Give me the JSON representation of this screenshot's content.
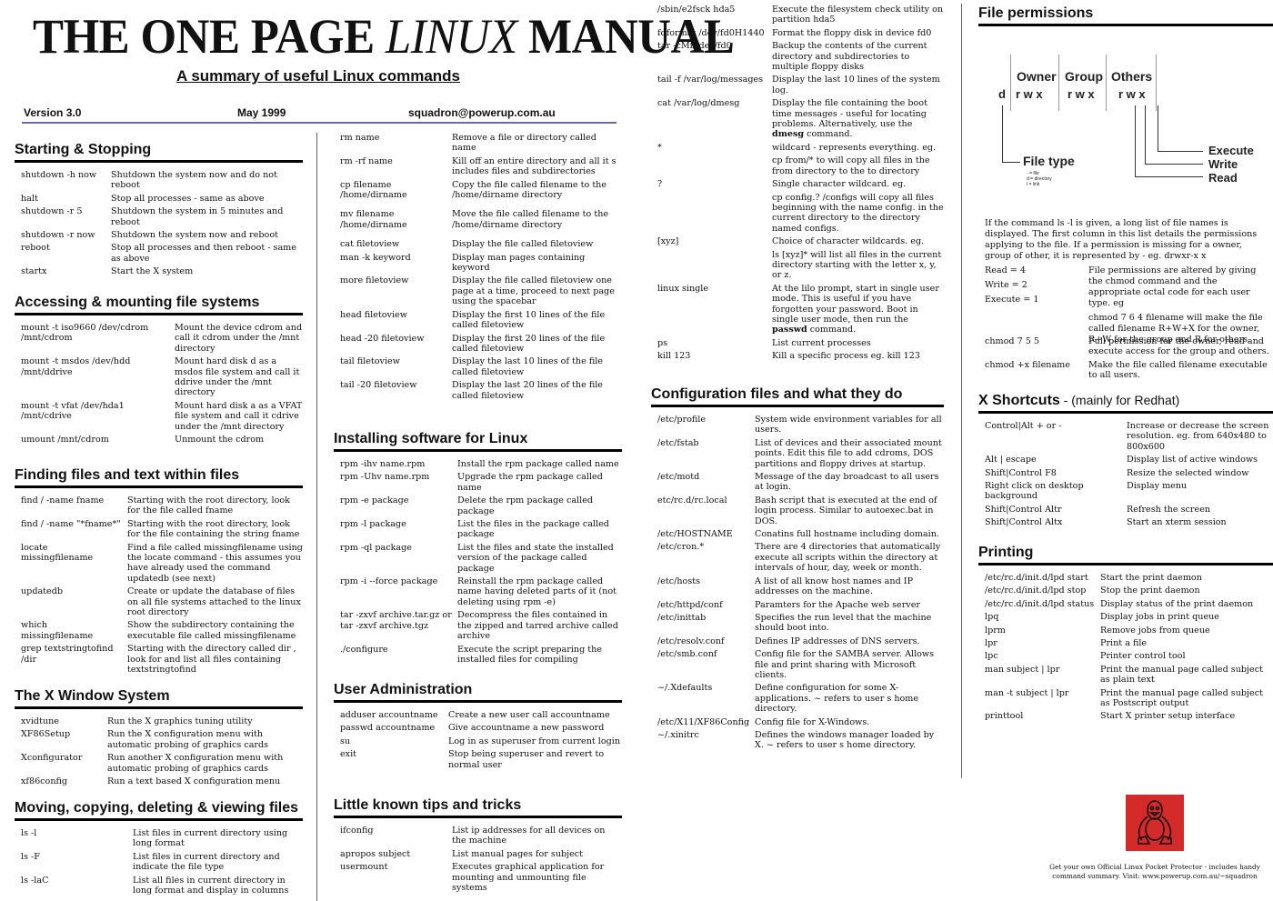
{
  "header": {
    "title_part1": "THE ONE PAGE ",
    "title_italic": "LINUX",
    "title_part2": " MANUAL",
    "subtitle": "A summary of useful Linux commands",
    "version": "Version 3.0",
    "date": "May 1999",
    "email": "squadron@powerup.com.au"
  },
  "sections": {
    "starting": {
      "title": "Starting & Stopping",
      "rows": [
        {
          "cmd": "shutdown -h now",
          "desc": "Shutdown the system now and do not reboot"
        },
        {
          "cmd": "halt",
          "desc": "Stop all processes - same as above"
        },
        {
          "cmd": "shutdown -r 5",
          "desc": "Shutdown the system in 5 minutes and reboot"
        },
        {
          "cmd": "shutdown -r now",
          "desc": "Shutdown the system now and reboot"
        },
        {
          "cmd": "reboot",
          "desc": "Stop all processes and then reboot - same as above"
        },
        {
          "cmd": "startx",
          "desc": "Start the X system"
        }
      ]
    },
    "mounting": {
      "title": "Accessing & mounting file systems",
      "rows": [
        {
          "cmd": "mount -t iso9660 /dev/cdrom /mnt/cdrom",
          "desc": "Mount the device cdrom and call it cdrom under the /mnt directory"
        },
        {
          "cmd": "mount -t msdos /dev/hdd /mnt/ddrive",
          "desc": "Mount hard disk  d  as a msdos file system and call it ddrive under the /mnt directory"
        },
        {
          "cmd": "mount -t vfat /dev/hda1 /mnt/cdrive",
          "desc": "Mount hard disk  a  as a VFAT file system and call it cdrive under the /mnt directory"
        },
        {
          "cmd": "umount /mnt/cdrom",
          "desc": "Unmount the cdrom"
        }
      ]
    },
    "finding": {
      "title": "Finding files and text within files",
      "rows": [
        {
          "cmd": "find / -name  fname",
          "desc": "Starting with the root directory, look for the file called fname"
        },
        {
          "cmd": "find / -name \"*fname*\"",
          "desc": "Starting with the root directory, look for the file containing the string fname"
        },
        {
          "cmd": "locate missingfilename",
          "desc": "Find a file called missingfilename using the locate command - this assumes you have already used the command updatedb (see next)"
        },
        {
          "cmd": "updatedb",
          "desc": "Create or update the database of files on all file systems attached to the linux root directory"
        },
        {
          "cmd": "which missingfilename",
          "desc": "Show the subdirectory containing the executable file  called missingfilename"
        },
        {
          "cmd": "grep textstringtofind /dir",
          "desc": "Starting with the directory called dir , look for and list all files containing textstringtofind"
        }
      ]
    },
    "xwindow": {
      "title": "The X Window System",
      "rows": [
        {
          "cmd": "xvidtune",
          "desc": "Run the X graphics tuning utility"
        },
        {
          "cmd": "XF86Setup",
          "desc": "Run the X configuration menu with automatic probing of graphics cards"
        },
        {
          "cmd": "Xconfigurator",
          "desc": "Run another X configuration menu with automatic probing of graphics cards"
        },
        {
          "cmd": "xf86config",
          "desc": "Run a text based X configuration menu"
        }
      ]
    },
    "moving": {
      "title": "Moving, copying, deleting & viewing files",
      "rows": [
        {
          "cmd": "ls -l",
          "desc": "List files in current directory using long format"
        },
        {
          "cmd": "ls -F",
          "desc": "List files in current directory and indicate the file type"
        },
        {
          "cmd": "ls -laC",
          "desc": "List all files in current directory in long format and display in columns"
        }
      ]
    },
    "moving_cont": {
      "rows": [
        {
          "cmd": "rm name",
          "desc": "Remove a file or directory called name"
        },
        {
          "cmd": "rm -rf name",
          "desc": "Kill off an entire directory and all it s includes files and subdirectories"
        },
        {
          "cmd": "cp filename /home/dirname",
          "desc": "Copy the file called filename to the /home/dirname directory"
        },
        {
          "cmd": "mv filename /home/dirname",
          "desc": "Move the file called filename to the /home/dirname directory"
        },
        {
          "cmd": "cat filetoview",
          "desc": "Display the file called filetoview"
        },
        {
          "cmd": "man -k keyword",
          "desc": "Display man pages containing keyword"
        },
        {
          "cmd": "more filetoview",
          "desc": "Display the file called filetoview one page at a time, proceed to next page using the spacebar"
        },
        {
          "cmd": "head filetoview",
          "desc": "Display the first 10 lines of the file called filetoview"
        },
        {
          "cmd": "head -20 filetoview",
          "desc": "Display the first 20 lines of the file called filetoview"
        },
        {
          "cmd": "tail filetoview",
          "desc": "Display the last 10 lines of the file called filetoview"
        },
        {
          "cmd": "tail -20 filetoview",
          "desc": "Display the last 20 lines of the file called filetoview"
        }
      ]
    },
    "installing": {
      "title": "Installing software for Linux",
      "rows": [
        {
          "cmd": "rpm -ihv name.rpm",
          "desc": "Install the rpm package called name"
        },
        {
          "cmd": "rpm -Uhv name.rpm",
          "desc": "Upgrade the rpm package called name"
        },
        {
          "cmd": "rpm -e package",
          "desc": "Delete the rpm package called package"
        },
        {
          "cmd": "rpm -l package",
          "desc": "List the files in the package called package"
        },
        {
          "cmd": "rpm -ql package",
          "desc": "List the files and state the installed version of the package called package"
        },
        {
          "cmd": "rpm -i --force package",
          "desc": "Reinstall the rpm package called name having deleted parts of it (not deleting using rpm -e)"
        },
        {
          "cmd": "tar -zxvf archive.tar.gz or tar -zxvf archive.tgz",
          "desc": "Decompress the files contained in the zipped and tarred archive called archive"
        },
        {
          "cmd": "./configure",
          "desc": "Execute the script preparing the installed files for compiling"
        }
      ]
    },
    "useradmin": {
      "title": "User Administration",
      "rows": [
        {
          "cmd": "adduser accountname",
          "desc": "Create a new user call accountname"
        },
        {
          "cmd": "passwd accountname",
          "desc": "Give accountname a new password"
        },
        {
          "cmd": "su",
          "desc": "Log in as superuser from current login"
        },
        {
          "cmd": "exit",
          "desc": "Stop being superuser and revert to normal user"
        }
      ]
    },
    "tips": {
      "title": "Little known tips and tricks",
      "rows": [
        {
          "cmd": "ifconfig",
          "desc": "List ip addresses for all devices on the machine"
        },
        {
          "cmd": "apropos subject",
          "desc": "List manual pages for subject"
        },
        {
          "cmd": "usermount",
          "desc": "Executes graphical application for mounting and unmounting file systems"
        }
      ]
    },
    "tips_cont": {
      "rows": [
        {
          "cmd": "/sbin/e2fsck hda5",
          "desc": "Execute the filesystem check utility on partition hda5"
        },
        {
          "cmd": "fdformat /dev/fd0H1440",
          "desc": "Format the floppy disk in device fd0"
        },
        {
          "cmd": "tar -cMf /dev/fd0",
          "desc": "Backup the contents of the current directory and subdirectories to multiple floppy disks"
        },
        {
          "cmd": "tail -f /var/log/messages",
          "desc": "Display the last 10 lines of the system log."
        },
        {
          "cmd": "cat /var/log/dmesg",
          "desc": "Display the file containing the boot time messages - useful for locating problems. Alternatively, use the",
          "desc_bold": "dmesg",
          "desc_tail": " command."
        },
        {
          "cmd": "*",
          "desc": "wildcard - represents everything. eg."
        },
        {
          "cmd": "",
          "desc": "cp from/* to  will copy all files in the from directory to the to directory"
        },
        {
          "cmd": "?",
          "desc": "Single character wildcard. eg."
        },
        {
          "cmd": "",
          "desc": "cp config.? /configs will copy all files beginning with the name config. in the current directory to the directory named configs."
        },
        {
          "cmd": "[xyz]",
          "desc": "Choice of character wildcards. eg."
        },
        {
          "cmd": "",
          "desc": "ls [xyz]* will list all files in the current directory starting with the letter x, y, or z."
        },
        {
          "cmd": "linux single",
          "desc": "At the lilo prompt, start in single user mode. This is useful if you have forgotten your password. Boot in single user mode, then run the",
          "desc_bold": "passwd",
          "desc_tail": " command."
        },
        {
          "cmd": "ps",
          "desc": "List current processes"
        },
        {
          "cmd": "kill 123",
          "desc": "Kill a specific process eg. kill 123"
        }
      ]
    },
    "config": {
      "title": "Configuration files and what they do",
      "rows": [
        {
          "cmd": "/etc/profile",
          "desc": "System wide environment variables for all users."
        },
        {
          "cmd": "/etc/fstab",
          "desc": "List of devices and their associated mount points. Edit this file to add cdroms, DOS partitions and floppy drives at startup."
        },
        {
          "cmd": "/etc/motd",
          "desc": "Message of the day broadcast to all users at login."
        },
        {
          "cmd": "etc/rc.d/rc.local",
          "desc": "Bash script that is executed at the end of login process. Similar to autoexec.bat in DOS."
        },
        {
          "cmd": "/etc/HOSTNAME",
          "desc": "Conatins full hostname including domain."
        },
        {
          "cmd": "/etc/cron.*",
          "desc": "There are 4 directories that automatically execute all scripts within the directory at intervals of hour, day, week or month."
        },
        {
          "cmd": "/etc/hosts",
          "desc": "A list of all know host names and IP addresses on the machine."
        },
        {
          "cmd": "/etc/httpd/conf",
          "desc": "Paramters for the Apache web server"
        },
        {
          "cmd": "/etc/inittab",
          "desc": "Specifies the run level that the machine should boot into."
        },
        {
          "cmd": "/etc/resolv.conf",
          "desc": "Defines IP addresses of DNS servers."
        },
        {
          "cmd": "/etc/smb.conf",
          "desc": "Config file for the SAMBA server. Allows file and print sharing with Microsoft clients."
        },
        {
          "cmd": "~/.Xdefaults",
          "desc": "Define configuration for some X-applications. ~ refers to user s home directory."
        },
        {
          "cmd": "/etc/X11/XF86Config",
          "desc": "Config file for X-Windows."
        },
        {
          "cmd": "~/.xinitrc",
          "desc": "Defines the windows manager loaded by X. ~ refers to user s home directory."
        }
      ]
    },
    "permissions": {
      "title": "File permissions",
      "diagram": {
        "owner": "Owner",
        "group": "Group",
        "others": "Others",
        "type_char": "d",
        "owner_bits": "r w x",
        "group_bits": "r w x",
        "others_bits": "r w x",
        "file_type": "File type",
        "file_type_legend": [
          "- = file",
          "d = directory",
          "l = link"
        ],
        "execute": "Execute",
        "write": "Write",
        "read": "Read"
      },
      "paragraph": "If the command ls -l is given, a long list of file names is displayed. The first column in this list details the permissions applying to the file. If a permission is missing for a owner, group of other, it is represented by - eg.  drwxr-x   x",
      "values": [
        "Read = 4",
        "Write = 2",
        "Execute = 1"
      ],
      "values_desc": "File permissions are altered by giving the chmod command and the appropriate octal code for each user type. eg",
      "example": "chmod 7 6 4 filename will make the file called filename R+W+X for the owner, R+W for the group and R for others.",
      "rows": [
        {
          "cmd": "chmod 7 5 5",
          "desc": "Full permission for the owner, read and execute access for the group and others."
        },
        {
          "cmd": "chmod +x filename",
          "desc": "Make the file called filename executable to all users."
        }
      ]
    },
    "xshortcuts": {
      "title": "X Shortcuts",
      "title_suffix": " - (mainly for Redhat)",
      "rows": [
        {
          "cmd": "Control|Alt  + or -",
          "desc": "Increase or decrease the screen resolution. eg. from 640x480 to 800x600"
        },
        {
          "cmd": "Alt | escape",
          "desc": "Display list of active windows"
        },
        {
          "cmd": "Shift|Control F8",
          "desc": "Resize the selected window"
        },
        {
          "cmd": "Right click on desktop background",
          "desc": "Display menu"
        },
        {
          "cmd": "Shift|Control Altr",
          "desc": "Refresh the screen"
        },
        {
          "cmd": "Shift|Control Altx",
          "desc": "Start an xterm session"
        }
      ]
    },
    "printing": {
      "title": "Printing",
      "rows": [
        {
          "cmd": "/etc/rc.d/init.d/lpd start",
          "desc": "Start the print daemon"
        },
        {
          "cmd": "/etc/rc.d/init.d/lpd stop",
          "desc": "Stop the print daemon"
        },
        {
          "cmd": "/etc/rc.d/init.d/lpd status",
          "desc": "Display status of the print daemon"
        },
        {
          "cmd": "lpq",
          "desc": "Display jobs in print queue"
        },
        {
          "cmd": "lprm",
          "desc": "Remove jobs from queue"
        },
        {
          "cmd": "lpr",
          "desc": "Print a file"
        },
        {
          "cmd": "lpc",
          "desc": "Printer control tool"
        },
        {
          "cmd": "man subject | lpr",
          "desc": "Print the manual page called subject as plain text"
        },
        {
          "cmd": "man -t subject | lpr",
          "desc": "Print the manual page called subject as Postscript output"
        },
        {
          "cmd": "printtool",
          "desc": "Start X printer setup interface"
        }
      ]
    }
  },
  "footer": {
    "logo_icon": "tux-penguin-icon",
    "logo_color": "#d42a2a",
    "promo": "Get your own Official Linux Pocket Protector - includes handy command summary. Visit: www.powerup.com.au/~squadron"
  }
}
